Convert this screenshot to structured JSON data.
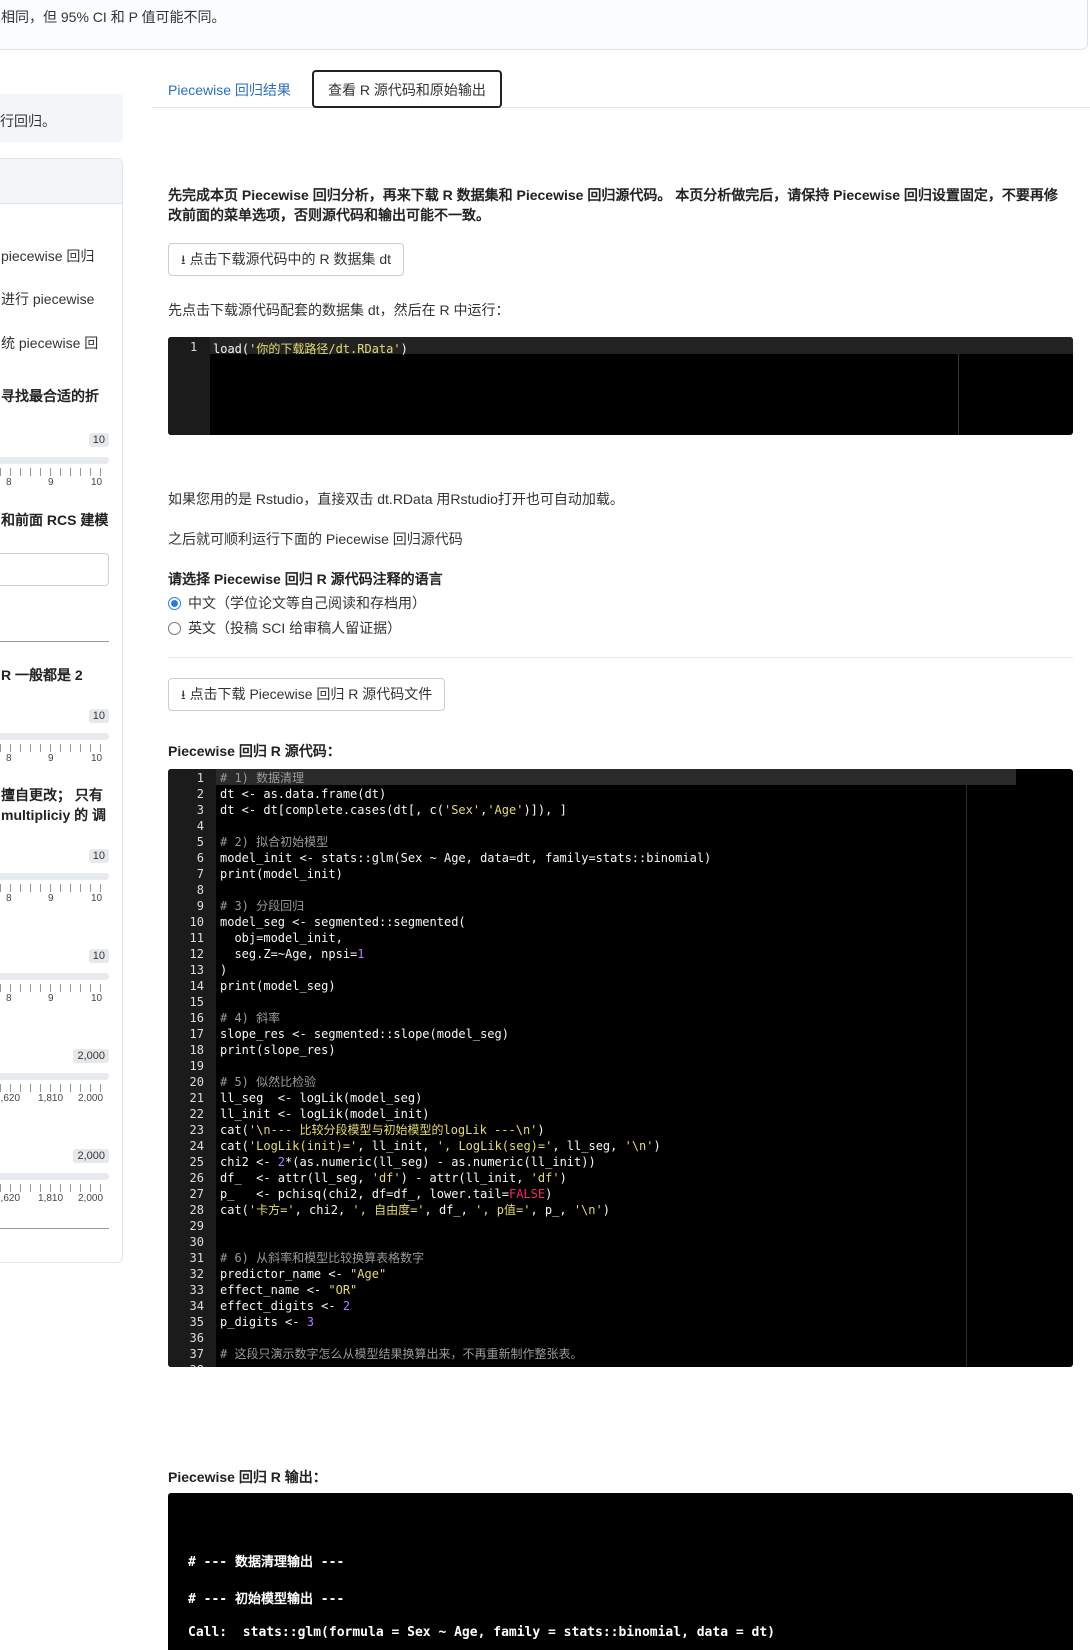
{
  "top_alert": "相同，但 95% CI 和 P 值可能不同。",
  "sidebar": {
    "note": "行回归。",
    "texts": [
      {
        "text": " piecewise 回归",
        "bold": false
      },
      {
        "text": "进行 piecewise",
        "bold": false
      },
      {
        "text": "统 piecewise 回",
        "bold": false
      },
      {
        "text": "寻找最合适的折",
        "bold": true
      },
      {
        "text": "和前面 RCS 建模",
        "bold": true
      },
      {
        "text": "R 一般都是 2",
        "bold": true
      },
      {
        "text": "擅自更改； 只有",
        "bold": true
      },
      {
        "text": "multipliciy 的 调",
        "bold": true
      }
    ],
    "sliders": [
      {
        "badge": "10",
        "labels": [
          "8",
          "9",
          "10"
        ]
      },
      {
        "badge": "10",
        "labels": [
          "8",
          "9",
          "10"
        ]
      },
      {
        "badge": "10",
        "labels": [
          "8",
          "9",
          "10"
        ]
      },
      {
        "badge": "10",
        "labels": [
          "8",
          "9",
          "10"
        ]
      },
      {
        "badge": "2,000",
        "labels": [
          "1,620",
          "1,810",
          "2,000"
        ]
      },
      {
        "badge": "2,000",
        "labels": [
          "1,620",
          "1,810",
          "2,000"
        ]
      }
    ]
  },
  "tabs": {
    "results": "Piecewise 回归结果",
    "source": "查看 R 源代码和原始输出"
  },
  "main": {
    "intro": "先完成本页 Piecewise 回归分析，再来下载 R 数据集和 Piecewise 回归源代码。 本页分析做完后，请保持 Piecewise 回归设置固定，不要再修",
    "intro2": "改前面的菜单选项，否则源代码和输出可能不一致。",
    "download_dataset": "点击下载源代码中的 R 数据集 dt",
    "load_hint": "先点击下载源代码配套的数据集 dt，然后在 R 中运行：",
    "load_code_ln": "1",
    "load_code_fn": "load(",
    "load_code_str": "'你的下载路径/dt.RData'",
    "load_code_end": ")",
    "rstudio_hint": "如果您用的是 Rstudio，直接双击 dt.RData 用Rstudio打开也可自动加载。",
    "next_hint": "之后就可顺利运行下面的 Piecewise 回归源代码",
    "lang_label": "请选择 Piecewise 回归 R 源代码注释的语言",
    "lang_zh": "中文（学位论文等自己阅读和存档用）",
    "lang_en": "英文（投稿 SCI 给审稿人留证据）",
    "download_source": "点击下载 Piecewise 回归 R 源代码文件",
    "source_label": "Piecewise 回归 R 源代码：",
    "output_label": "Piecewise 回归 R 输出："
  },
  "code_lines": [
    "# 1) 数据清理",
    "dt <- as.data.frame(dt)",
    "dt <- dt[complete.cases(dt[, c('Sex','Age')]), ]",
    "",
    "# 2) 拟合初始模型",
    "model_init <- stats::glm(Sex ~ Age, data=dt, family=stats::binomial)",
    "print(model_init)",
    "",
    "# 3) 分段回归",
    "model_seg <- segmented::segmented(",
    "  obj=model_init,",
    "  seg.Z=~Age, npsi=1",
    ")",
    "print(model_seg)",
    "",
    "# 4) 斜率",
    "slope_res <- segmented::slope(model_seg)",
    "print(slope_res)",
    "",
    "# 5) 似然比检验",
    "ll_seg  <- logLik(model_seg)",
    "ll_init <- logLik(model_init)",
    "cat('\\n--- 比较分段模型与初始模型的logLik ---\\n')",
    "cat('LogLik(init)=', ll_init, ', LogLik(seg)=', ll_seg, '\\n')",
    "chi2 <- 2*(as.numeric(ll_seg) - as.numeric(ll_init))",
    "df_  <- attr(ll_seg, 'df') - attr(ll_init, 'df')",
    "p_   <- pchisq(chi2, df=df_, lower.tail=FALSE)",
    "cat('卡方=', chi2, ', 自由度=', df_, ', p值=', p_, '\\n')",
    "",
    "",
    "# 6) 从斜率和模型比较换算表格数字",
    "predictor_name <- \"Age\"",
    "effect_name <- \"OR\"",
    "effect_digits <- 2",
    "p_digits <- 3",
    "",
    "# 这段只演示数字怎么从模型结果换算出来，不再重新制作整张表。",
    ""
  ],
  "output_lines": [
    "# --- 数据清理输出 ---",
    "# --- 初始模型输出 ---",
    "Call:  stats::glm(formula = Sex ~ Age, family = stats::binomial, data = dt)"
  ]
}
